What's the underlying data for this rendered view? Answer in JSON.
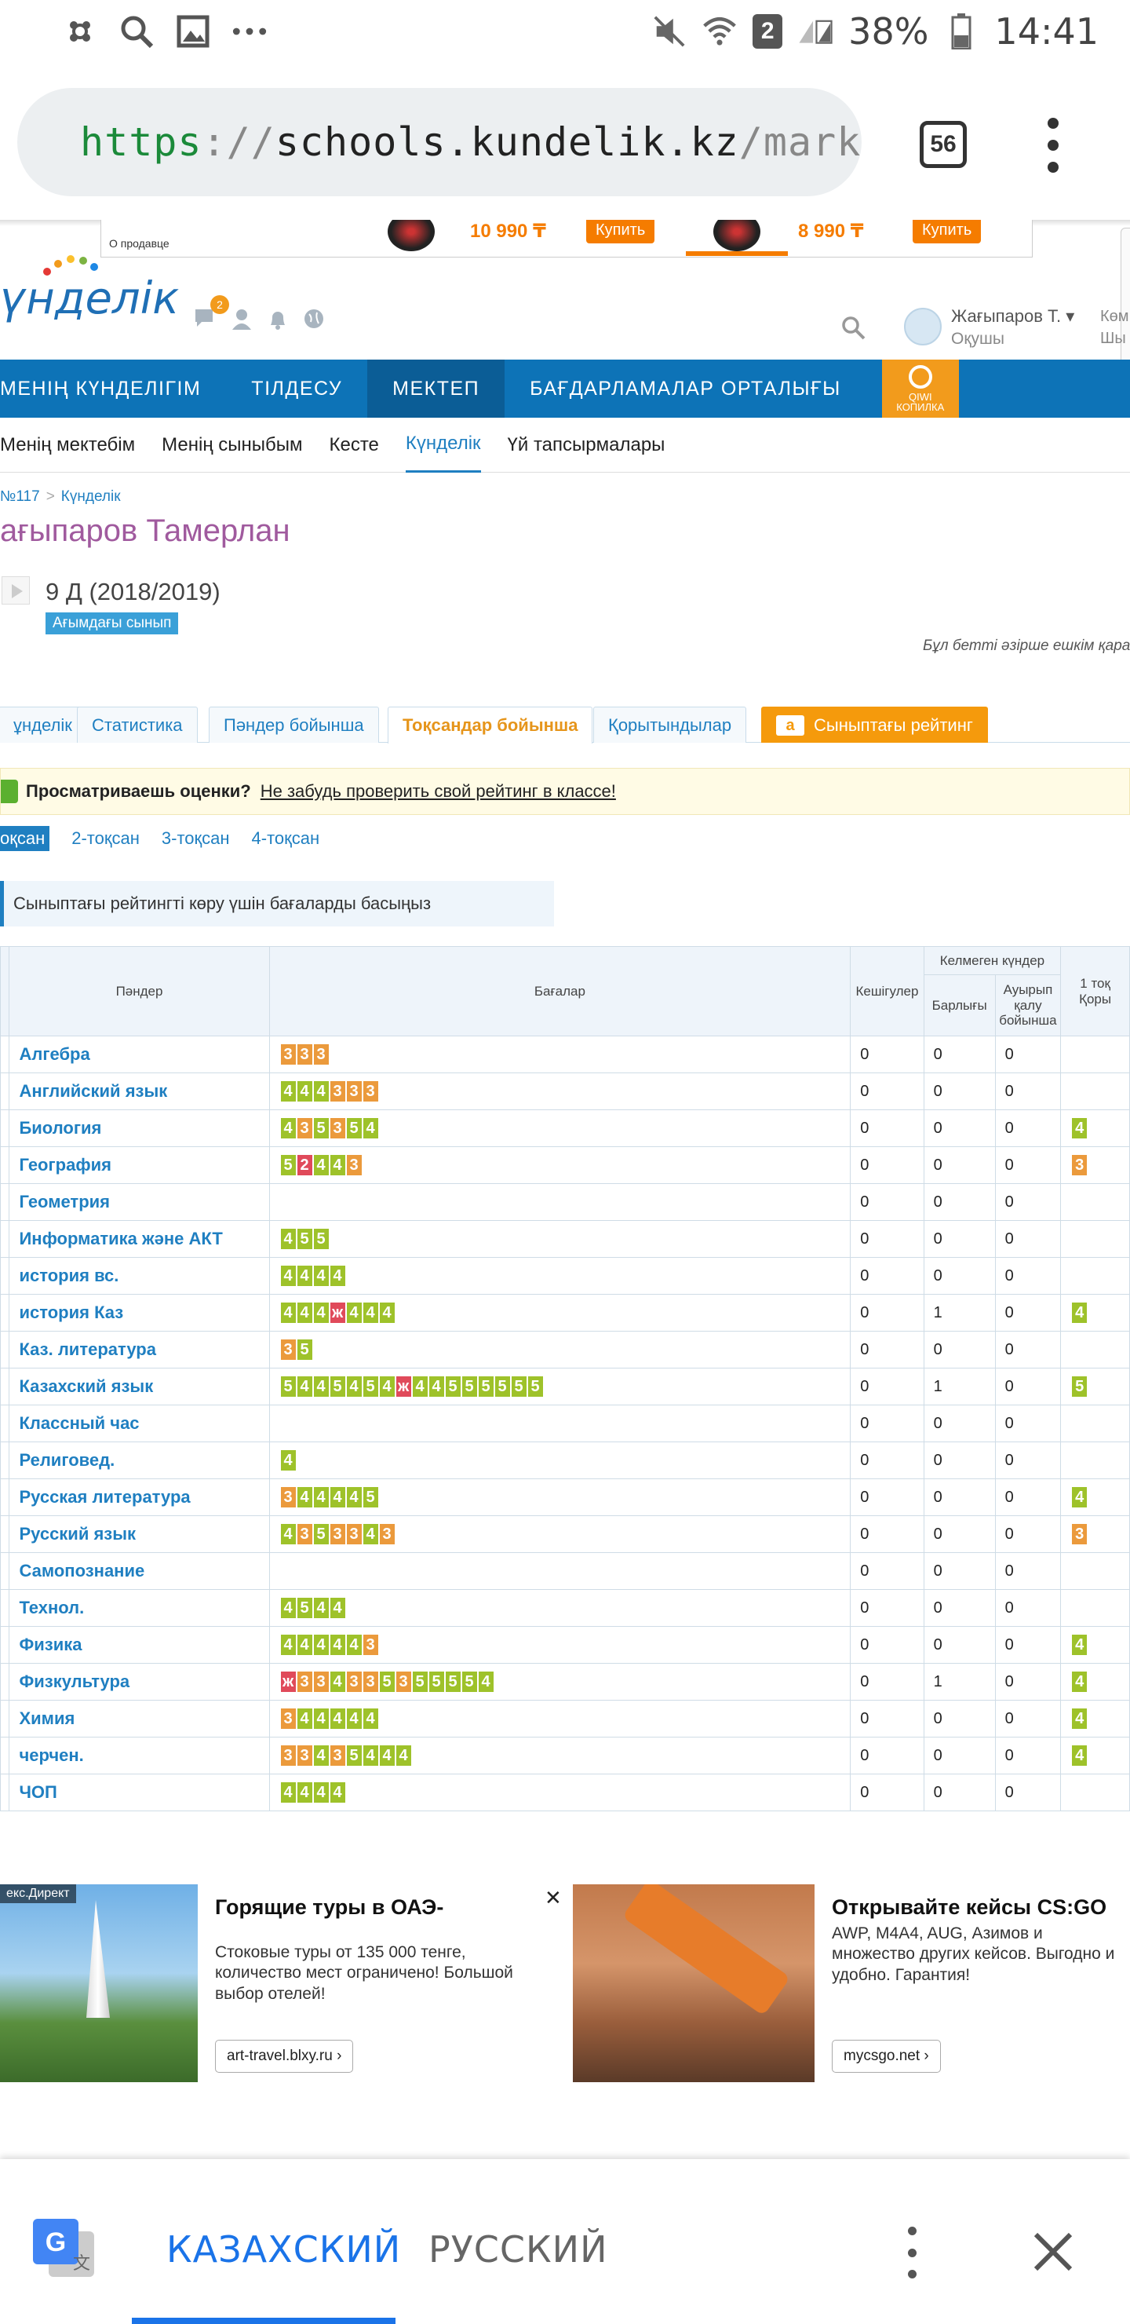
{
  "status_bar": {
    "wifi_badge": "2",
    "battery": "38%",
    "time": "14:41",
    "icons": [
      "settings-icon",
      "search-icon",
      "image-icon",
      "more-icon",
      "mute-icon",
      "wifi-icon",
      "signal-icon",
      "battery-icon"
    ]
  },
  "browser": {
    "url_scheme": "https",
    "url_sep": "://",
    "url_host": "schools.kundelik.kz",
    "url_path": "/marks.a",
    "tab_count": "56"
  },
  "top_ad": {
    "seller": "О продавце",
    "price1": "10 990 ₸",
    "price2": "8 990 ₸",
    "buy1": "Купить",
    "buy2": "Купить"
  },
  "site": {
    "logo": "үнделік",
    "notification_count": "2",
    "user_name": "Жағыпаров Т. ▾",
    "user_role": "Оқушы",
    "cut1": "Көм",
    "cut2": "Шы"
  },
  "main_nav": {
    "items": [
      "МЕНІҢ КҮНДЕЛІГІМ",
      "ТІЛДЕСУ",
      "МЕКТЕП",
      "БАҒДАРЛАМАЛАР ОРТАЛЫҒЫ"
    ],
    "active_index": 2,
    "kopilka_line1": "QIWI",
    "kopilka_line2": "КОПИЛКА"
  },
  "sub_nav": {
    "items": [
      "Менің мектебім",
      "Менің сыныбым",
      "Кесте",
      "Күнделік",
      "Үй тапсырмалары"
    ],
    "active_index": 3
  },
  "breadcrumb": {
    "school": "№117",
    "sep": ">",
    "current": "Күнделік"
  },
  "student": {
    "name": "ағыпаров Тамерлан",
    "class": "9 Д (2018/2019)",
    "class_badge": "Ағымдағы сынып",
    "edit_note": "Бұл бетті әзірше ешкім қара"
  },
  "tabs": {
    "items": [
      "ұнделік",
      "Статистика",
      "Пәндер бойынша",
      "Тоқсандар бойынша",
      "Қорытындылар",
      "Сыныптағы рейтинг"
    ],
    "active_index": 3,
    "rating_icon_text": "a"
  },
  "promo": {
    "question": "Просматриваешь оценки?",
    "link": "Не забудь проверить свой рейтинг в классе!"
  },
  "quarters": {
    "items": [
      "оқсан",
      "2-тоқсан",
      "3-тоқсан",
      "4-тоқсан"
    ],
    "active_index": 0
  },
  "hint": "Сыныптағы рейтингті көру үшін бағаларды басыңыз",
  "table": {
    "headers": {
      "subjects": "Пәндер",
      "grades": "Бағалар",
      "late": "Кешігулер",
      "absent_group": "Келмеген күндер",
      "absent_total": "Барлығы",
      "absent_sick": "Ауырып қалу бойынша",
      "q1_line1": "1 тоқ",
      "q1_line2": "Қоры"
    },
    "rows": [
      {
        "subject": "Алгебра",
        "grades": [
          {
            "v": "3",
            "c": "o"
          },
          {
            "v": "3",
            "c": "o"
          },
          {
            "v": "3",
            "c": "o"
          }
        ],
        "late": "0",
        "absent": "0",
        "sick": "0",
        "final": null
      },
      {
        "subject": "Английский язык",
        "grades": [
          {
            "v": "4",
            "c": "g"
          },
          {
            "v": "4",
            "c": "g"
          },
          {
            "v": "4",
            "c": "g"
          },
          {
            "v": "3",
            "c": "o"
          },
          {
            "v": "3",
            "c": "o"
          },
          {
            "v": "3",
            "c": "o"
          }
        ],
        "late": "0",
        "absent": "0",
        "sick": "0",
        "final": null
      },
      {
        "subject": "Биология",
        "grades": [
          {
            "v": "4",
            "c": "g"
          },
          {
            "v": "3",
            "c": "o"
          },
          {
            "v": "5",
            "c": "g"
          },
          {
            "v": "3",
            "c": "o"
          },
          {
            "v": "5",
            "c": "g"
          },
          {
            "v": "4",
            "c": "g"
          }
        ],
        "late": "0",
        "absent": "0",
        "sick": "0",
        "final": {
          "v": "4",
          "c": "g"
        }
      },
      {
        "subject": "География",
        "grades": [
          {
            "v": "5",
            "c": "g"
          },
          {
            "v": "2",
            "c": "r"
          },
          {
            "v": "4",
            "c": "g"
          },
          {
            "v": "4",
            "c": "g"
          },
          {
            "v": "3",
            "c": "o"
          }
        ],
        "late": "0",
        "absent": "0",
        "sick": "0",
        "final": {
          "v": "3",
          "c": "o"
        }
      },
      {
        "subject": "Геометрия",
        "grades": [],
        "late": "0",
        "absent": "0",
        "sick": "0",
        "final": null
      },
      {
        "subject": "Информатика және АКТ",
        "grades": [
          {
            "v": "4",
            "c": "g"
          },
          {
            "v": "5",
            "c": "g"
          },
          {
            "v": "5",
            "c": "g"
          }
        ],
        "late": "0",
        "absent": "0",
        "sick": "0",
        "final": null
      },
      {
        "subject": "история вс.",
        "grades": [
          {
            "v": "4",
            "c": "g"
          },
          {
            "v": "4",
            "c": "g"
          },
          {
            "v": "4",
            "c": "g"
          },
          {
            "v": "4",
            "c": "g"
          }
        ],
        "late": "0",
        "absent": "0",
        "sick": "0",
        "final": null
      },
      {
        "subject": "история Каз",
        "grades": [
          {
            "v": "4",
            "c": "g"
          },
          {
            "v": "4",
            "c": "g"
          },
          {
            "v": "4",
            "c": "g"
          },
          {
            "v": "ж",
            "c": "r"
          },
          {
            "v": "4",
            "c": "g"
          },
          {
            "v": "4",
            "c": "g"
          },
          {
            "v": "4",
            "c": "g"
          }
        ],
        "late": "0",
        "absent": "1",
        "sick": "0",
        "final": {
          "v": "4",
          "c": "g"
        }
      },
      {
        "subject": "Каз. литература",
        "grades": [
          {
            "v": "3",
            "c": "o"
          },
          {
            "v": "5",
            "c": "g"
          }
        ],
        "late": "0",
        "absent": "0",
        "sick": "0",
        "final": null
      },
      {
        "subject": "Казахский язык",
        "grades": [
          {
            "v": "5",
            "c": "g"
          },
          {
            "v": "4",
            "c": "g"
          },
          {
            "v": "4",
            "c": "g"
          },
          {
            "v": "5",
            "c": "g"
          },
          {
            "v": "4",
            "c": "g"
          },
          {
            "v": "5",
            "c": "g"
          },
          {
            "v": "4",
            "c": "g"
          },
          {
            "v": "ж",
            "c": "r"
          },
          {
            "v": "4",
            "c": "g"
          },
          {
            "v": "4",
            "c": "g"
          },
          {
            "v": "5",
            "c": "g"
          },
          {
            "v": "5",
            "c": "g"
          },
          {
            "v": "5",
            "c": "g"
          },
          {
            "v": "5",
            "c": "g"
          },
          {
            "v": "5",
            "c": "g"
          },
          {
            "v": "5",
            "c": "g"
          }
        ],
        "late": "0",
        "absent": "1",
        "sick": "0",
        "final": {
          "v": "5",
          "c": "g"
        }
      },
      {
        "subject": "Классный час",
        "grades": [],
        "late": "0",
        "absent": "0",
        "sick": "0",
        "final": null
      },
      {
        "subject": "Религовед.",
        "grades": [
          {
            "v": "4",
            "c": "g"
          }
        ],
        "late": "0",
        "absent": "0",
        "sick": "0",
        "final": null
      },
      {
        "subject": "Русская литература",
        "grades": [
          {
            "v": "3",
            "c": "o"
          },
          {
            "v": "4",
            "c": "g"
          },
          {
            "v": "4",
            "c": "g"
          },
          {
            "v": "4",
            "c": "g"
          },
          {
            "v": "4",
            "c": "g"
          },
          {
            "v": "5",
            "c": "g"
          }
        ],
        "late": "0",
        "absent": "0",
        "sick": "0",
        "final": {
          "v": "4",
          "c": "g"
        }
      },
      {
        "subject": "Русский язык",
        "grades": [
          {
            "v": "4",
            "c": "g"
          },
          {
            "v": "3",
            "c": "o"
          },
          {
            "v": "5",
            "c": "g"
          },
          {
            "v": "3",
            "c": "o"
          },
          {
            "v": "3",
            "c": "o"
          },
          {
            "v": "4",
            "c": "g"
          },
          {
            "v": "3",
            "c": "o"
          }
        ],
        "late": "0",
        "absent": "0",
        "sick": "0",
        "final": {
          "v": "3",
          "c": "o"
        }
      },
      {
        "subject": "Самопознание",
        "grades": [],
        "late": "0",
        "absent": "0",
        "sick": "0",
        "final": null
      },
      {
        "subject": "Технол.",
        "grades": [
          {
            "v": "4",
            "c": "g"
          },
          {
            "v": "5",
            "c": "g"
          },
          {
            "v": "4",
            "c": "g"
          },
          {
            "v": "4",
            "c": "g"
          }
        ],
        "late": "0",
        "absent": "0",
        "sick": "0",
        "final": null
      },
      {
        "subject": "Физика",
        "grades": [
          {
            "v": "4",
            "c": "g"
          },
          {
            "v": "4",
            "c": "g"
          },
          {
            "v": "4",
            "c": "g"
          },
          {
            "v": "4",
            "c": "g"
          },
          {
            "v": "4",
            "c": "g"
          },
          {
            "v": "3",
            "c": "o"
          }
        ],
        "late": "0",
        "absent": "0",
        "sick": "0",
        "final": {
          "v": "4",
          "c": "g"
        }
      },
      {
        "subject": "Физкультура",
        "grades": [
          {
            "v": "ж",
            "c": "r"
          },
          {
            "v": "3",
            "c": "o"
          },
          {
            "v": "3",
            "c": "o"
          },
          {
            "v": "4",
            "c": "g"
          },
          {
            "v": "3",
            "c": "o"
          },
          {
            "v": "3",
            "c": "o"
          },
          {
            "v": "5",
            "c": "g"
          },
          {
            "v": "3",
            "c": "o"
          },
          {
            "v": "5",
            "c": "g"
          },
          {
            "v": "5",
            "c": "g"
          },
          {
            "v": "5",
            "c": "g"
          },
          {
            "v": "5",
            "c": "g"
          },
          {
            "v": "4",
            "c": "g"
          }
        ],
        "late": "0",
        "absent": "1",
        "sick": "0",
        "final": {
          "v": "4",
          "c": "g"
        }
      },
      {
        "subject": "Химия",
        "grades": [
          {
            "v": "3",
            "c": "o"
          },
          {
            "v": "4",
            "c": "g"
          },
          {
            "v": "4",
            "c": "g"
          },
          {
            "v": "4",
            "c": "g"
          },
          {
            "v": "4",
            "c": "g"
          },
          {
            "v": "4",
            "c": "g"
          }
        ],
        "late": "0",
        "absent": "0",
        "sick": "0",
        "final": {
          "v": "4",
          "c": "g"
        }
      },
      {
        "subject": "черчен.",
        "grades": [
          {
            "v": "3",
            "c": "o"
          },
          {
            "v": "3",
            "c": "o"
          },
          {
            "v": "4",
            "c": "g"
          },
          {
            "v": "3",
            "c": "o"
          },
          {
            "v": "5",
            "c": "g"
          },
          {
            "v": "4",
            "c": "g"
          },
          {
            "v": "4",
            "c": "g"
          },
          {
            "v": "4",
            "c": "g"
          }
        ],
        "late": "0",
        "absent": "0",
        "sick": "0",
        "final": {
          "v": "4",
          "c": "g"
        }
      },
      {
        "subject": "ЧОП",
        "grades": [
          {
            "v": "4",
            "c": "g"
          },
          {
            "v": "4",
            "c": "g"
          },
          {
            "v": "4",
            "c": "g"
          },
          {
            "v": "4",
            "c": "g"
          }
        ],
        "late": "0",
        "absent": "0",
        "sick": "0",
        "final": null
      }
    ]
  },
  "ads": {
    "tag": "екс.Директ",
    "ad1_title": "Горящие туры в ОАЭ-",
    "ad1_desc": "Стоковые туры от 135 000 тенге, количество мест ограничено! Большой выбор отелей!",
    "ad1_btn": "art-travel.blxy.ru ›",
    "ad2_title": "Открывайте кейсы CS:GO",
    "ad2_desc": "AWP, M4A4, AUG, Азимов и множество других кейсов. Выгодно и удобно. Гарантия!",
    "ad2_btn": "mycsgo.net ›",
    "close": "✕"
  },
  "translate": {
    "source_lang": "КАЗАХСКИЙ",
    "target_lang": "РУССКИЙ"
  },
  "colors": {
    "nav_blue": "#0d73b7",
    "grade_green": "#9ec22a",
    "grade_orange": "#eb9a3c",
    "grade_red": "#e04a5a",
    "accent_orange": "#f59a0c"
  }
}
